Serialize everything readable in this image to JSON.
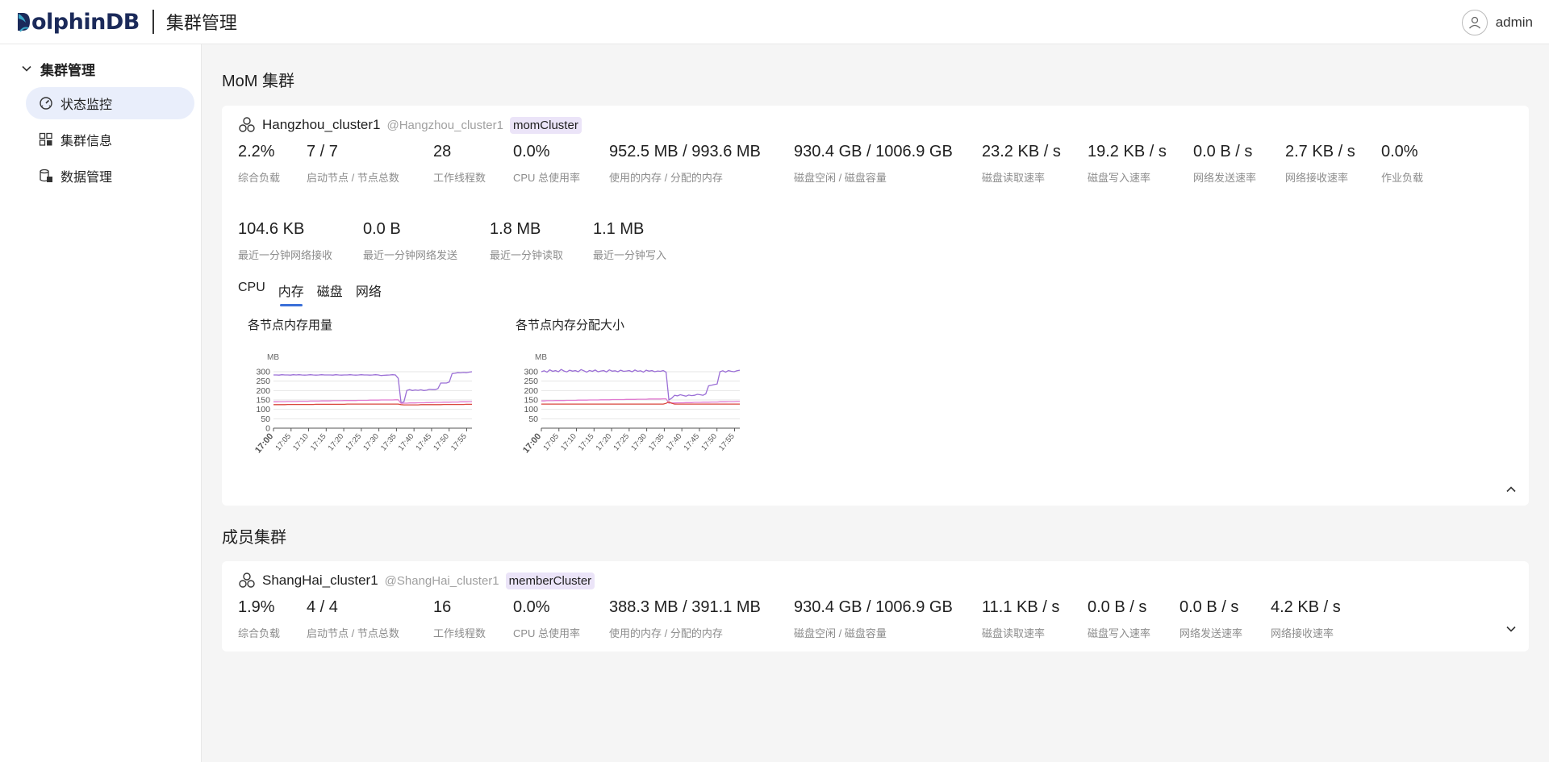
{
  "header": {
    "logo_rest": "olphinDB",
    "title": "集群管理",
    "user": "admin"
  },
  "sidebar": {
    "group_label": "集群管理",
    "items": [
      {
        "label": "状态监控",
        "icon": "gauge-icon"
      },
      {
        "label": "集群信息",
        "icon": "grid-icon"
      },
      {
        "label": "数据管理",
        "icon": "database-icon"
      }
    ]
  },
  "mom": {
    "section_title": "MoM 集群",
    "cluster_name": "Hangzhou_cluster1",
    "alias": "@Hangzhou_cluster1",
    "tag": "momCluster",
    "metrics_row1": [
      {
        "value": "2.2%",
        "label": "综合负载"
      },
      {
        "value": "7 / 7",
        "label": "启动节点 / 节点总数"
      },
      {
        "value": "28",
        "label": "工作线程数"
      },
      {
        "value": "0.0%",
        "label": "CPU 总使用率"
      },
      {
        "value": "952.5 MB / 993.6 MB",
        "label": "使用的内存 / 分配的内存"
      },
      {
        "value": "930.4 GB / 1006.9 GB",
        "label": "磁盘空闲 / 磁盘容量"
      },
      {
        "value": "23.2 KB / s",
        "label": "磁盘读取速率"
      },
      {
        "value": "19.2 KB / s",
        "label": "磁盘写入速率"
      },
      {
        "value": "0.0 B / s",
        "label": "网络发送速率"
      },
      {
        "value": "2.7 KB / s",
        "label": "网络接收速率"
      },
      {
        "value": "0.0%",
        "label": "作业负载"
      }
    ],
    "metrics_row2": [
      {
        "value": "104.6 KB",
        "label": "最近一分钟网络接收"
      },
      {
        "value": "0.0 B",
        "label": "最近一分钟网络发送"
      },
      {
        "value": "1.8 MB",
        "label": "最近一分钟读取"
      },
      {
        "value": "1.1 MB",
        "label": "最近一分钟写入"
      }
    ],
    "tabs": [
      "CPU",
      "内存",
      "磁盘",
      "网络"
    ],
    "active_tab": 1
  },
  "member": {
    "section_title": "成员集群",
    "cluster_name": "ShangHai_cluster1",
    "alias": "@ShangHai_cluster1",
    "tag": "memberCluster",
    "metrics": [
      {
        "value": "1.9%",
        "label": "综合负载"
      },
      {
        "value": "4 / 4",
        "label": "启动节点 / 节点总数"
      },
      {
        "value": "16",
        "label": "工作线程数"
      },
      {
        "value": "0.0%",
        "label": "CPU 总使用率"
      },
      {
        "value": "388.3 MB / 391.1 MB",
        "label": "使用的内存 / 分配的内存"
      },
      {
        "value": "930.4 GB / 1006.9 GB",
        "label": "磁盘空闲 / 磁盘容量"
      },
      {
        "value": "11.1 KB / s",
        "label": "磁盘读取速率"
      },
      {
        "value": "0.0 B / s",
        "label": "磁盘写入速率"
      },
      {
        "value": "0.0 B / s",
        "label": "网络发送速率"
      },
      {
        "value": "4.2 KB / s",
        "label": "网络接收速率"
      }
    ]
  },
  "colors": {
    "accent": "#3a6fd8",
    "series": [
      "#9b6fd6",
      "#e07bd0",
      "#d9463b"
    ]
  },
  "chart_data": [
    {
      "type": "line",
      "title": "各节点内存用量",
      "ylabel": "MB",
      "ylim": [
        0,
        300
      ],
      "yticks": [
        0,
        50,
        100,
        150,
        200,
        250,
        300
      ],
      "xticks": [
        "17:00",
        "17:05",
        "17:10",
        "17:15",
        "17:20",
        "17:25",
        "17:30",
        "17:35",
        "17:40",
        "17:45",
        "17:50",
        "17:55"
      ],
      "series": [
        {
          "values": [
            283,
            283,
            282,
            284,
            283,
            283,
            282,
            284,
            283,
            284,
            283,
            282,
            283,
            284,
            283,
            282,
            283,
            284,
            283,
            283,
            283,
            282,
            284,
            283,
            282,
            283,
            283,
            284,
            283,
            282,
            283,
            284,
            283,
            283,
            282,
            283,
            284,
            283,
            280,
            281,
            282,
            283,
            284,
            283,
            265,
            135,
            140,
            200,
            205,
            200,
            203,
            201,
            204,
            200,
            202,
            206,
            205,
            205,
            210,
            240,
            240,
            240,
            245,
            290,
            292,
            295,
            294,
            296,
            295,
            298,
            300
          ]
        },
        {
          "values": [
            140,
            140,
            141,
            141,
            141,
            142,
            142,
            142,
            142,
            143,
            143,
            143,
            143,
            144,
            144,
            144,
            144,
            145,
            145,
            145,
            145,
            146,
            146,
            146,
            146,
            147,
            147,
            147,
            147,
            147,
            148,
            148,
            148,
            148,
            149,
            149,
            149,
            149,
            150,
            150,
            150,
            150,
            150,
            151,
            151,
            132,
            133,
            133,
            134,
            134,
            134,
            135,
            135,
            135,
            136,
            136,
            136,
            137,
            137,
            137,
            138,
            138,
            138,
            139,
            139,
            139,
            140,
            140,
            140,
            141,
            141
          ]
        },
        {
          "values": [
            125,
            125,
            125,
            125,
            125,
            126,
            126,
            126,
            126,
            126,
            126,
            126,
            126,
            126,
            126,
            127,
            127,
            127,
            127,
            127,
            127,
            127,
            127,
            127,
            127,
            127,
            128,
            128,
            128,
            128,
            128,
            128,
            128,
            128,
            128,
            128,
            128,
            128,
            128,
            128,
            128,
            128,
            128,
            128,
            128,
            125,
            124,
            124,
            124,
            124,
            124,
            124,
            125,
            125,
            125,
            125,
            125,
            125,
            125,
            125,
            126,
            126,
            126,
            126,
            126,
            126,
            126,
            126,
            127,
            127,
            127
          ]
        }
      ]
    },
    {
      "type": "line",
      "title": "各节点内存分配大小",
      "ylabel": "MB",
      "ylim": [
        0,
        300
      ],
      "yticks": [
        50,
        100,
        150,
        200,
        250,
        300
      ],
      "xticks": [
        "17:00",
        "17:05",
        "17:10",
        "17:15",
        "17:20",
        "17:25",
        "17:30",
        "17:35",
        "17:40",
        "17:45",
        "17:50",
        "17:55"
      ],
      "series": [
        {
          "values": [
            300,
            305,
            298,
            310,
            302,
            306,
            300,
            312,
            304,
            299,
            308,
            303,
            306,
            300,
            311,
            305,
            298,
            307,
            302,
            309,
            300,
            304,
            306,
            299,
            310,
            303,
            305,
            300,
            308,
            302,
            304,
            306,
            300,
            309,
            302,
            305,
            298,
            308,
            303,
            306,
            300,
            304,
            302,
            306,
            298,
            150,
            160,
            175,
            172,
            178,
            174,
            170,
            176,
            173,
            175,
            180,
            178,
            175,
            182,
            225,
            228,
            232,
            235,
            300,
            305,
            298,
            306,
            302,
            300,
            305,
            308
          ]
        },
        {
          "values": [
            145,
            145,
            146,
            146,
            146,
            147,
            147,
            147,
            147,
            148,
            148,
            148,
            148,
            149,
            149,
            149,
            149,
            150,
            150,
            150,
            150,
            151,
            151,
            151,
            151,
            152,
            152,
            152,
            152,
            152,
            153,
            153,
            153,
            153,
            154,
            154,
            154,
            154,
            155,
            155,
            155,
            155,
            155,
            156,
            156,
            133,
            134,
            134,
            135,
            135,
            135,
            136,
            136,
            136,
            137,
            137,
            137,
            138,
            138,
            138,
            139,
            139,
            139,
            140,
            140,
            140,
            141,
            141,
            141,
            142,
            142
          ]
        },
        {
          "values": [
            128,
            128,
            128,
            128,
            128,
            128,
            128,
            128,
            128,
            128,
            128,
            128,
            128,
            128,
            128,
            128,
            128,
            128,
            128,
            128,
            128,
            128,
            128,
            128,
            128,
            128,
            128,
            128,
            128,
            128,
            128,
            128,
            128,
            128,
            128,
            128,
            128,
            128,
            128,
            128,
            128,
            128,
            128,
            128,
            132,
            140,
            132,
            128,
            128,
            128,
            128,
            128,
            128,
            128,
            128,
            128,
            128,
            128,
            128,
            128,
            128,
            128,
            128,
            128,
            128,
            128,
            128,
            128,
            128,
            128,
            128
          ]
        }
      ]
    }
  ]
}
